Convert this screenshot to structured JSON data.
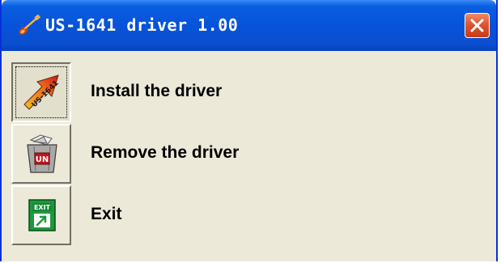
{
  "window": {
    "title": "US-1641 driver 1.00",
    "app_icon": "guitar-icon",
    "close_icon": "close-icon"
  },
  "menu": {
    "items": [
      {
        "label": "Install the driver",
        "icon": "us-1641-install-icon",
        "icon_text": "US-1641",
        "selected": true
      },
      {
        "label": "Remove the driver",
        "icon": "trash-bin-uninstall-icon",
        "icon_text": "UN",
        "selected": false
      },
      {
        "label": "Exit",
        "icon": "exit-door-icon",
        "icon_text": "EXIT",
        "selected": false
      }
    ]
  },
  "colors": {
    "titlebar": "#0653d9",
    "window_bg": "#ece9d8",
    "close_button": "#e3542e"
  }
}
